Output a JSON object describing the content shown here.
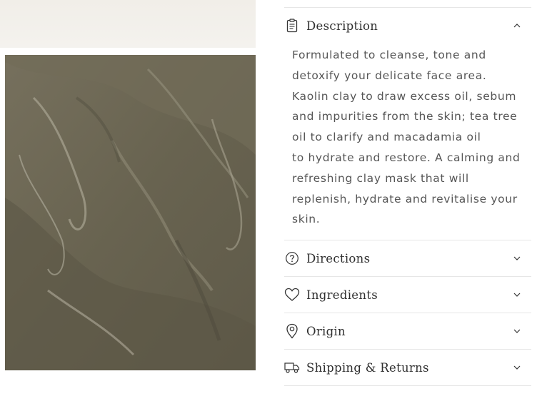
{
  "product_images": {
    "top_image_name": "product-image-top",
    "main_image_name": "clay-texture-image"
  },
  "accordion": [
    {
      "title": "Description",
      "icon": "clipboard-icon",
      "expanded": true,
      "body_lines": [
        "Formulated to cleanse, tone and",
        "detoxify your delicate face area.",
        "Kaolin clay to draw excess oil, sebum",
        "and impurities from the skin; tea tree",
        "oil to clarify and macadamia oil",
        "to hydrate and restore. A calming and",
        "refreshing clay mask that will",
        "replenish, hydrate and revitalise your",
        "skin."
      ]
    },
    {
      "title": "Directions",
      "icon": "question-circle-icon",
      "expanded": false
    },
    {
      "title": "Ingredients",
      "icon": "heart-icon",
      "expanded": false
    },
    {
      "title": "Origin",
      "icon": "map-pin-icon",
      "expanded": false
    },
    {
      "title": "Shipping & Returns",
      "icon": "truck-icon",
      "expanded": false
    }
  ],
  "colors": {
    "clay": "#6c6755",
    "text": "#555555",
    "heading": "#2f2f2f",
    "divider": "#e6e6e6"
  }
}
